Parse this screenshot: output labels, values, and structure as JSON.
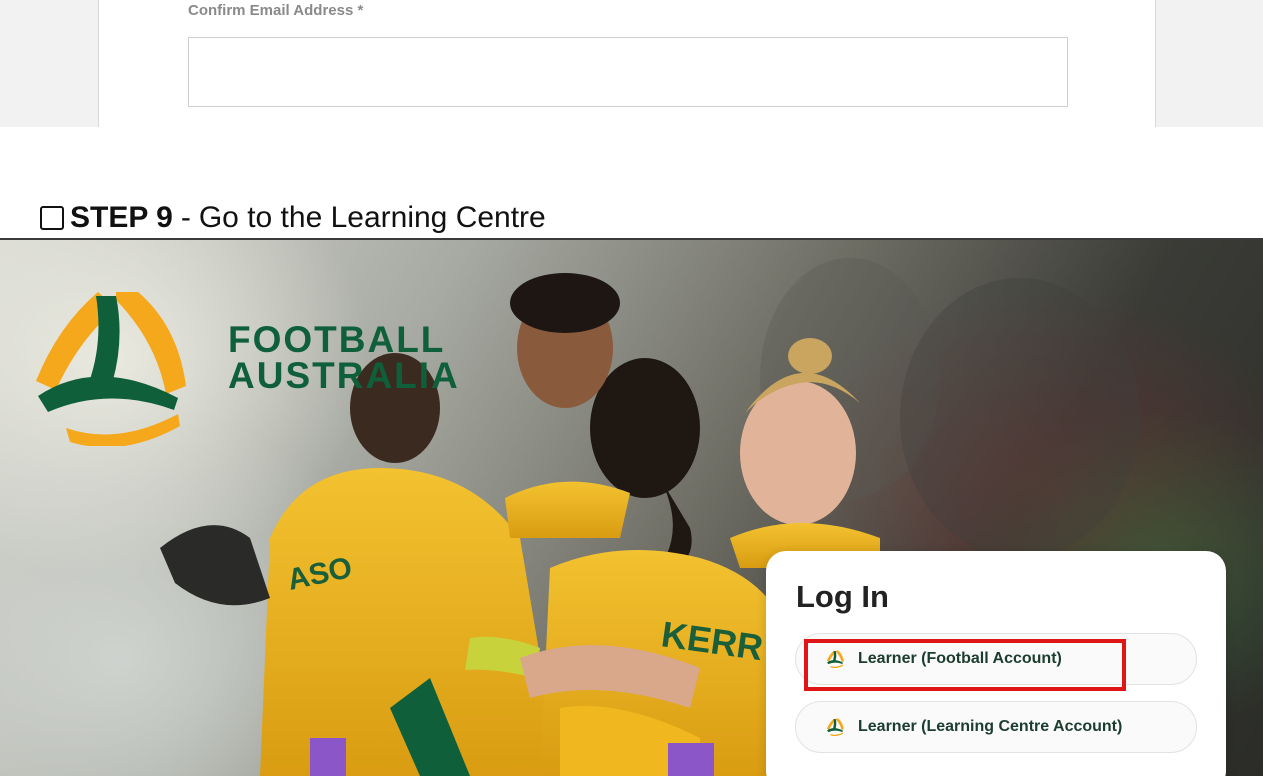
{
  "form": {
    "confirm_email_label": "Confirm Email Address *",
    "confirm_email_value": "",
    "confirm_email_placeholder": ""
  },
  "step": {
    "number": "STEP 9",
    "separator": "-",
    "text": "Go to the Learning Centre"
  },
  "hero": {
    "logo_line1": "FOOTBALL",
    "logo_line2": "AUSTRALIA",
    "jersey_name_1": "KERR",
    "jersey_name_2": "ASO"
  },
  "login": {
    "title": "Log In",
    "options": [
      {
        "label": "Learner (Football Account)",
        "highlighted": true
      },
      {
        "label": "Learner (Learning Centre Account)",
        "highlighted": false
      }
    ]
  },
  "colors": {
    "brand_green": "#0e5f3a",
    "brand_gold": "#f5a81c",
    "highlight_red": "#e01515",
    "jersey_yellow": "#f0b81e"
  },
  "icons": {
    "step_checkbox": "checkbox-empty-icon",
    "login_option": "football-australia-logo-icon"
  }
}
